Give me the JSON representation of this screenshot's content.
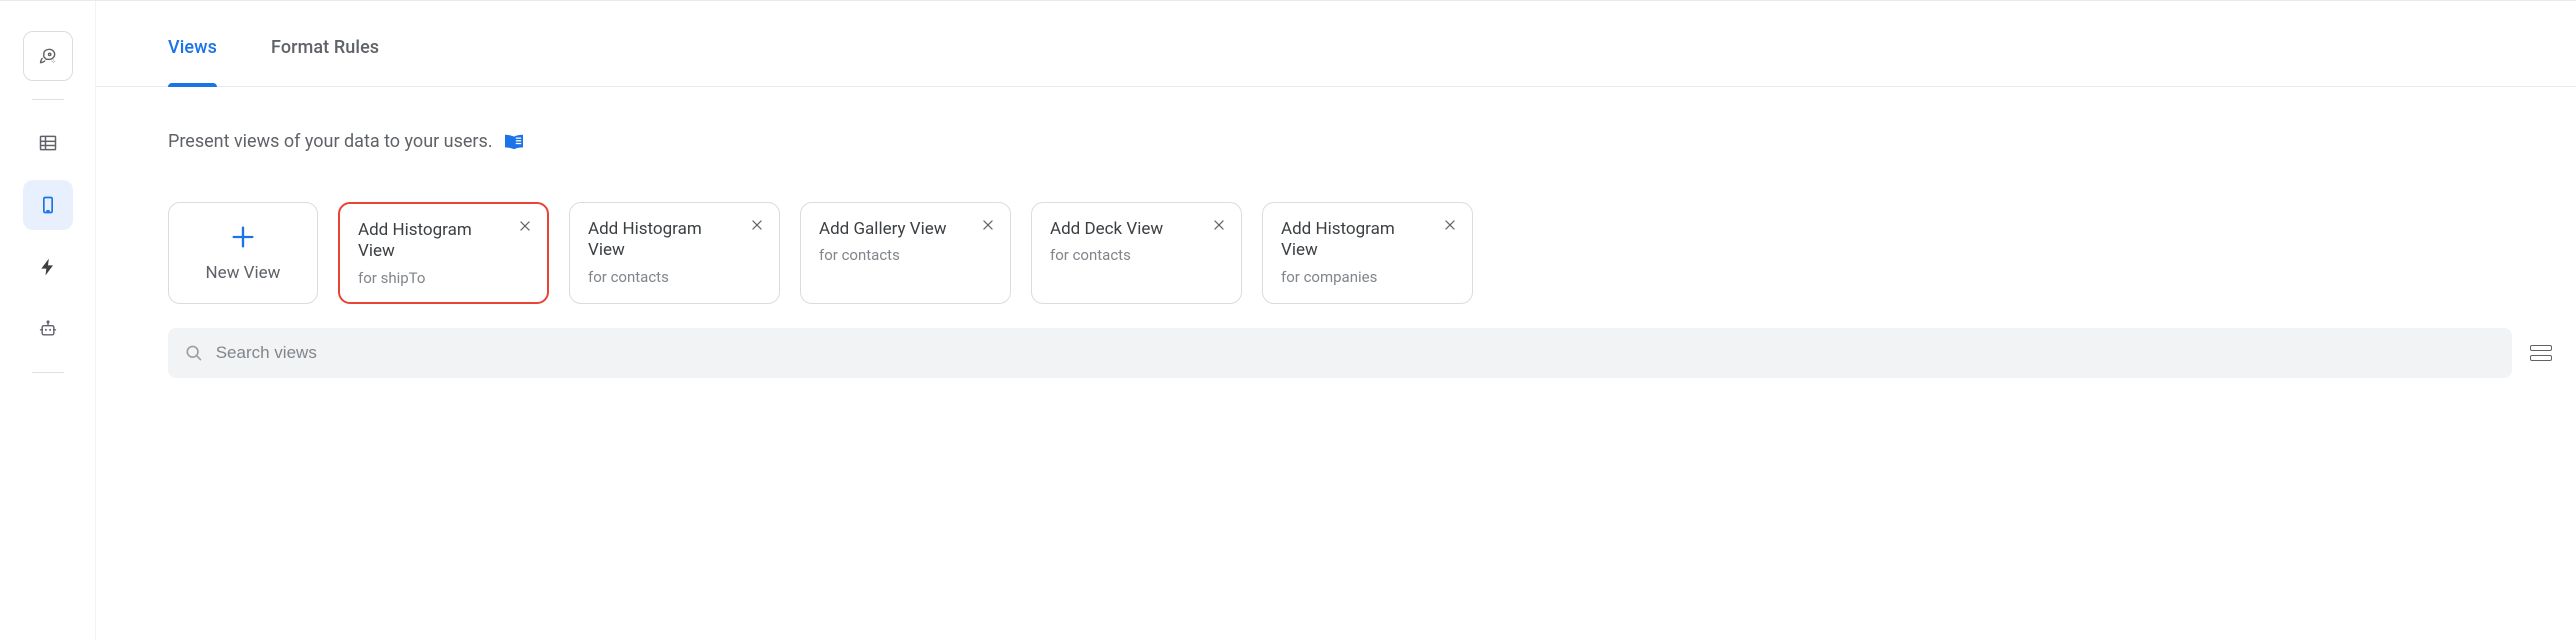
{
  "tabs": {
    "views": "Views",
    "format_rules": "Format Rules"
  },
  "description": "Present views of your data to your users.",
  "new_view_label": "New View",
  "cards": [
    {
      "title": "Add Histogram View",
      "subtitle": "for shipTo",
      "selected": true
    },
    {
      "title": "Add Histogram View",
      "subtitle": "for contacts",
      "selected": false
    },
    {
      "title": "Add Gallery View",
      "subtitle": "for contacts",
      "selected": false
    },
    {
      "title": "Add Deck View",
      "subtitle": "for contacts",
      "selected": false
    },
    {
      "title": "Add Histogram View",
      "subtitle": "for companies",
      "selected": false
    }
  ],
  "search": {
    "placeholder": "Search views"
  }
}
